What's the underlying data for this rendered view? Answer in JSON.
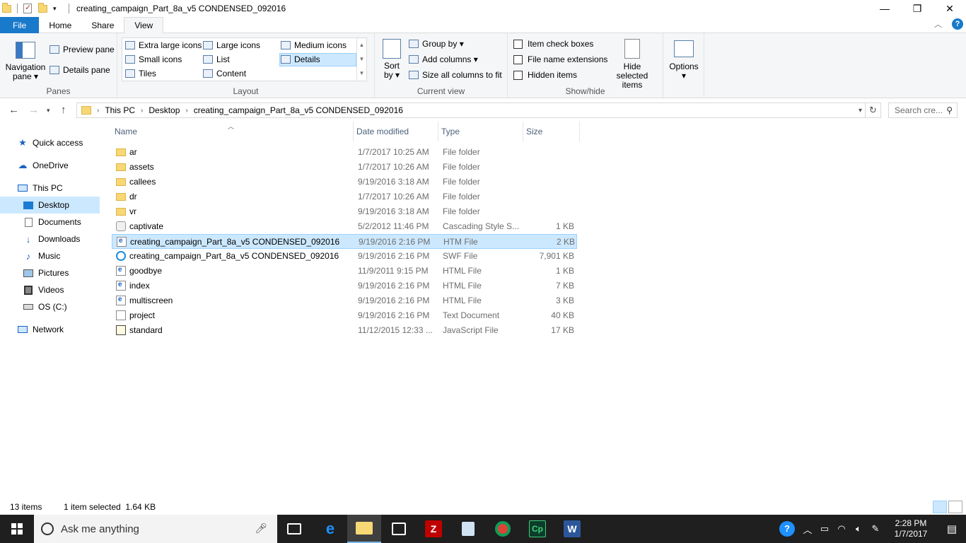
{
  "window": {
    "title": "creating_campaign_Part_8a_v5 CONDENSED_092016",
    "controls": {
      "minimize": "—",
      "maximize": "❐",
      "close": "✕"
    }
  },
  "ribbon_tabs": [
    "File",
    "Home",
    "Share",
    "View"
  ],
  "active_tab": "View",
  "ribbon": {
    "panes": {
      "label": "Panes",
      "navigation_pane": "Navigation\npane ▾",
      "preview_pane": "Preview pane",
      "details_pane": "Details pane"
    },
    "layout": {
      "label": "Layout",
      "options": [
        "Extra large icons",
        "Large icons",
        "Medium icons",
        "Small icons",
        "List",
        "Details",
        "Tiles",
        "Content"
      ],
      "selected": "Details"
    },
    "current_view": {
      "label": "Current view",
      "sort_by": "Sort\nby ▾",
      "group_by": "Group by ▾",
      "add_columns": "Add columns ▾",
      "size_all_columns": "Size all columns to fit"
    },
    "show_hide": {
      "label": "Show/hide",
      "item_check_boxes": "Item check boxes",
      "file_name_extensions": "File name extensions",
      "hidden_items": "Hidden items",
      "hide_selected_items": "Hide selected\nitems"
    },
    "options": {
      "label": "Options ▾"
    }
  },
  "address": {
    "breadcrumb": [
      "This PC",
      "Desktop",
      "creating_campaign_Part_8a_v5 CONDENSED_092016"
    ],
    "search_placeholder": "Search cre..."
  },
  "nav_pane": {
    "items": [
      {
        "label": "Quick access",
        "icon": "star-icon"
      },
      {
        "label": "OneDrive",
        "icon": "cloud-icon"
      },
      {
        "label": "This PC",
        "icon": "computer-icon"
      },
      {
        "label": "Desktop",
        "icon": "desktop-icon"
      },
      {
        "label": "Documents",
        "icon": "documents-icon"
      },
      {
        "label": "Downloads",
        "icon": "download-icon"
      },
      {
        "label": "Music",
        "icon": "music-icon"
      },
      {
        "label": "Pictures",
        "icon": "pictures-icon"
      },
      {
        "label": "Videos",
        "icon": "videos-icon"
      },
      {
        "label": "OS (C:)",
        "icon": "drive-icon"
      },
      {
        "label": "Network",
        "icon": "network-icon"
      }
    ],
    "selected": "Desktop"
  },
  "columns": [
    "Name",
    "Date modified",
    "Type",
    "Size"
  ],
  "files": [
    {
      "name": "ar",
      "date": "1/7/2017 10:25 AM",
      "type": "File folder",
      "size": "",
      "icon": "folder-icon"
    },
    {
      "name": "assets",
      "date": "1/7/2017 10:26 AM",
      "type": "File folder",
      "size": "",
      "icon": "folder-icon"
    },
    {
      "name": "callees",
      "date": "9/19/2016 3:18 AM",
      "type": "File folder",
      "size": "",
      "icon": "folder-icon"
    },
    {
      "name": "dr",
      "date": "1/7/2017 10:26 AM",
      "type": "File folder",
      "size": "",
      "icon": "folder-icon"
    },
    {
      "name": "vr",
      "date": "9/19/2016 3:18 AM",
      "type": "File folder",
      "size": "",
      "icon": "folder-icon"
    },
    {
      "name": "captivate",
      "date": "5/2/2012 11:46 PM",
      "type": "Cascading Style S...",
      "size": "1 KB",
      "icon": "css-file-icon"
    },
    {
      "name": "creating_campaign_Part_8a_v5 CONDENSED_092016",
      "date": "9/19/2016 2:16 PM",
      "type": "HTM File",
      "size": "2 KB",
      "icon": "htm-file-icon"
    },
    {
      "name": "creating_campaign_Part_8a_v5 CONDENSED_092016",
      "date": "9/19/2016 2:16 PM",
      "type": "SWF File",
      "size": "7,901 KB",
      "icon": "swf-file-icon"
    },
    {
      "name": "goodbye",
      "date": "11/9/2011 9:15 PM",
      "type": "HTML File",
      "size": "1 KB",
      "icon": "html-file-icon"
    },
    {
      "name": "index",
      "date": "9/19/2016 2:16 PM",
      "type": "HTML File",
      "size": "7 KB",
      "icon": "html-file-icon"
    },
    {
      "name": "multiscreen",
      "date": "9/19/2016 2:16 PM",
      "type": "HTML File",
      "size": "3 KB",
      "icon": "html-file-icon"
    },
    {
      "name": "project",
      "date": "9/19/2016 2:16 PM",
      "type": "Text Document",
      "size": "40 KB",
      "icon": "text-file-icon"
    },
    {
      "name": "standard",
      "date": "11/12/2015 12:33 ...",
      "type": "JavaScript File",
      "size": "17 KB",
      "icon": "js-file-icon"
    }
  ],
  "selected_file_index": 6,
  "status": {
    "item_count": "13 items",
    "selection": "1 item selected  1.64 KB"
  },
  "taskbar": {
    "search_placeholder": "Ask me anything",
    "clock_time": "2:28 PM",
    "clock_date": "1/7/2017"
  }
}
